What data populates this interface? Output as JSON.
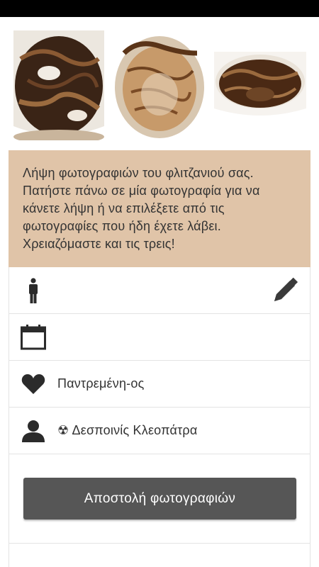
{
  "photos": [
    {
      "name": "cup-photo-1"
    },
    {
      "name": "cup-photo-2"
    },
    {
      "name": "cup-photo-3"
    }
  ],
  "instructions": {
    "text": "Λήψη φωτογραφιών του φλιτζανιού σας. Πατήστε πάνω σε μία φωτογραφία για να κάνετε λήψη ή να επιλέξετε από τις φωτογραφίες που ήδη έχετε λάβει. Χρειαζόμαστε και τις τρεις!",
    "background": "#e0c4a8"
  },
  "form": {
    "gender": {
      "icon": "person-icon",
      "value": ""
    },
    "birthdate": {
      "icon": "calendar-icon",
      "value": ""
    },
    "marital_status": {
      "icon": "heart-icon",
      "value": "Παντρεμένη-ος"
    },
    "reader": {
      "icon": "user-icon",
      "value": "☢ Δεσποινίς Κλεοπάτρα"
    },
    "edit_icon": "pencil-icon"
  },
  "submit": {
    "label": "Αποστολή φωτογραφιών",
    "color": "#565656"
  }
}
